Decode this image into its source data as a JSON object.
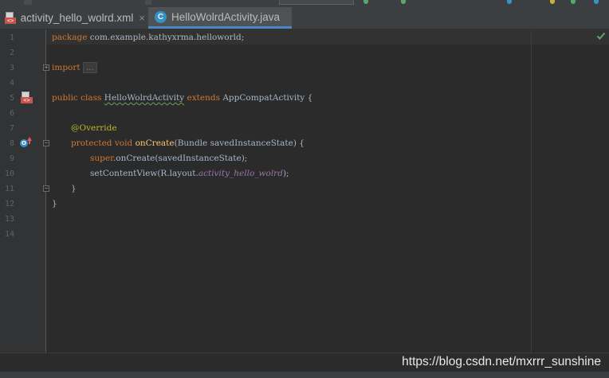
{
  "tabs": [
    {
      "label": "activity_hello_wolrd.xml",
      "icon": "xml-layout-icon",
      "active": false
    },
    {
      "label": "HelloWolrdActivity.java",
      "icon": "java-class-icon",
      "active": true
    }
  ],
  "tab_close_glyph": "×",
  "line_numbers": [
    "1",
    "2",
    "3",
    "4",
    "5",
    "6",
    "7",
    "8",
    "9",
    "10",
    "11",
    "12",
    "13",
    "14"
  ],
  "code": {
    "line1_kw": "package",
    "line1_pkg": " com.example.kathyxrma.helloworld;",
    "line3_kw": "import",
    "line3_folded": "...",
    "line6_kw1": "public",
    "line6_kw2": "class",
    "line6_name": "HelloWolrdActivity",
    "line6_kw3": "extends",
    "line6_rest": " AppCompatActivity {",
    "line8_ann": "@Override",
    "line9_kw1": "protected",
    "line9_kw2": "void",
    "line9_fn": "onCreate",
    "line9_rest": "(Bundle savedInstanceState) {",
    "line10_kw": "super",
    "line10_rest": ".onCreate(savedInstanceState);",
    "line11_pre": "setContentView(R.layout.",
    "line11_field": "activity_hello_wolrd",
    "line11_post": ");",
    "line12": "}",
    "line13": "}"
  },
  "watermark": "https://blog.csdn.net/mxrrr_sunshine",
  "colors": {
    "keyword": "#cc7832",
    "annotation": "#bbb529",
    "method": "#ffc66d",
    "field": "#9876aa",
    "text": "#a9b7c6",
    "background": "#2b2b2b",
    "gutter": "#313335",
    "active_tab_underline": "#4a88c7"
  }
}
